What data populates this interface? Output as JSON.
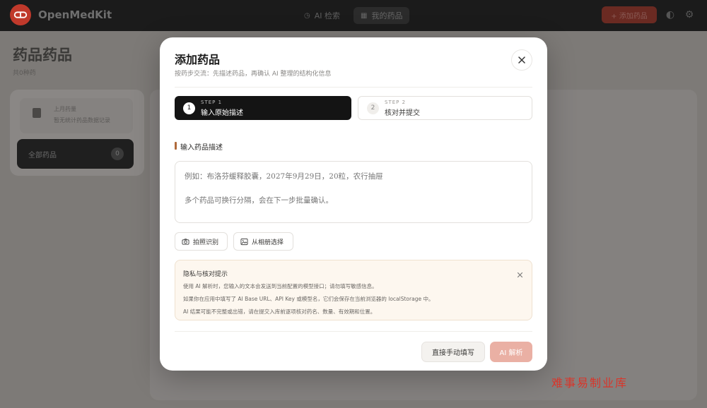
{
  "app": {
    "name": "OpenMedKit",
    "nav": [
      {
        "label": "AI 检索",
        "icon": "clock-icon"
      },
      {
        "label": "我的药品",
        "icon": "grid-icon"
      }
    ],
    "add_button_label": "+ 添加药品",
    "brand_color": "#c0392b"
  },
  "page": {
    "title": "药品药品",
    "subtitle": "共0种药"
  },
  "sidebar": {
    "row_line1": "上月药量",
    "row_line2": "暂无统计药品数据记录",
    "all_label": "全部药品",
    "all_count": "0"
  },
  "modal": {
    "title": "添加药品",
    "subtitle": "按药步交流：先描述药品，再确认 AI 整理的结构化信息",
    "steps": [
      {
        "key": "STEP 1",
        "label": "输入原始描述",
        "num": "1"
      },
      {
        "key": "STEP 2",
        "label": "核对并提交",
        "num": "2"
      }
    ],
    "section_label": "输入药品描述",
    "textarea_placeholder": "例如：布洛芬缓释胶囊，2027年9月29日，20粒，农行抽屉\n\n多个药品可换行分隔，会在下一步批量确认。",
    "buttons": {
      "photo": "拍照识别",
      "album": "从相册选择",
      "manual": "直接手动填写",
      "parse": "AI 解析"
    },
    "notice": {
      "title": "隐私与核对提示",
      "line1": "使用 AI 解析时，您输入的文本会发送到当前配置的模型接口；请勿填写敏感信息。",
      "line2": "如果你在应用中填写了 AI Base URL、API Key 或模型名，它们会保存在当前浏览器的 localStorage 中。",
      "line3": "AI 结果可能不完整或出错，请在提交入库前逐项核对药名、数量、有效期和位置。"
    },
    "accent_color": "#b06a3b",
    "parse_color": "#eab0a4"
  },
  "watermark": "难事易制业库"
}
